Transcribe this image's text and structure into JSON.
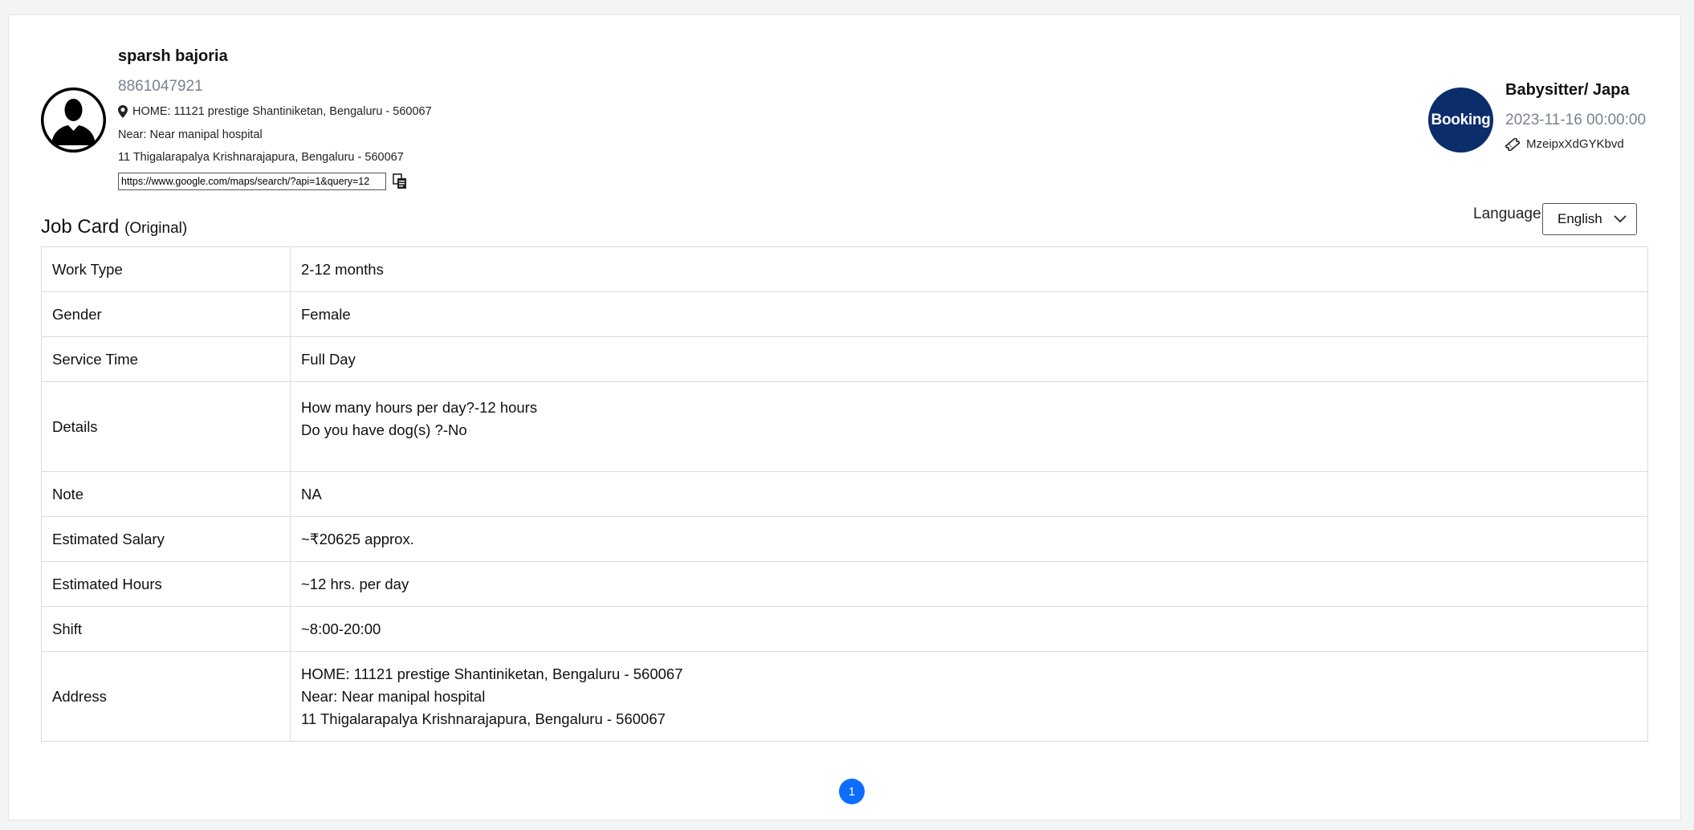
{
  "customer": {
    "name": "sparsh bajoria",
    "phone": "8861047921",
    "address_line1": "HOME: 11121 prestige Shantiniketan, Bengaluru - 560067",
    "address_line2": "Near: Near manipal hospital",
    "address_line3": "11 Thigalarapalya Krishnarajapura, Bengaluru - 560067",
    "map_url": "https://www.google.com/maps/search/?api=1&query=12"
  },
  "booking": {
    "badge_label": "Booking",
    "service": "Babysitter/ Japa",
    "datetime": "2023-11-16 00:00:00",
    "booking_id": "MzeipxXdGYKbvd"
  },
  "jobcard": {
    "title": "Job Card",
    "subtitle": "(Original)",
    "language_label": "Language",
    "language_value": "English",
    "rows": [
      {
        "label": "Work Type",
        "value": [
          "2-12 months"
        ]
      },
      {
        "label": "Gender",
        "value": [
          "Female"
        ]
      },
      {
        "label": "Service Time",
        "value": [
          "Full Day"
        ]
      },
      {
        "label": "Details",
        "value": [
          "How many hours per day?-12 hours",
          "Do you have dog(s) ?-No"
        ]
      },
      {
        "label": "Note",
        "value": [
          "NA"
        ]
      },
      {
        "label": "Estimated Salary",
        "value": [
          "~₹20625 approx."
        ]
      },
      {
        "label": "Estimated Hours",
        "value": [
          "~12 hrs. per day"
        ]
      },
      {
        "label": "Shift",
        "value": [
          "~8:00-20:00"
        ]
      },
      {
        "label": "Address",
        "value": [
          "HOME: 11121 prestige Shantiniketan, Bengaluru - 560067",
          "Near: Near manipal hospital",
          "11 Thigalarapalya Krishnarajapura, Bengaluru - 560067"
        ]
      }
    ]
  },
  "pagination": {
    "current_page": "1"
  }
}
